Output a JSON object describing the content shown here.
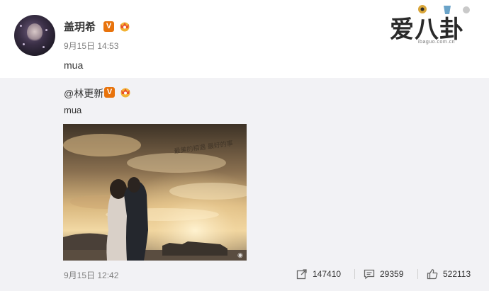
{
  "post": {
    "username": "盖玥希",
    "timestamp": "9月15日 14:53",
    "text": "mua"
  },
  "watermark": {
    "logo_text": "爱八卦",
    "logo_url": "ibaguo.com.cn"
  },
  "repost": {
    "author": "@林更新",
    "text": "mua",
    "photo_caption": "最美的相遇 最好的事",
    "timestamp": "9月15日 12:42",
    "forward_count": "147410",
    "comment_count": "29359",
    "like_count": "522113"
  },
  "colors": {
    "verified_badge": "#e8730c",
    "panel_bg": "#f2f2f5",
    "meta_text": "#808080"
  },
  "icons": [
    "verified-icon",
    "crown-icon",
    "forward-icon",
    "comment-icon",
    "like-icon"
  ]
}
